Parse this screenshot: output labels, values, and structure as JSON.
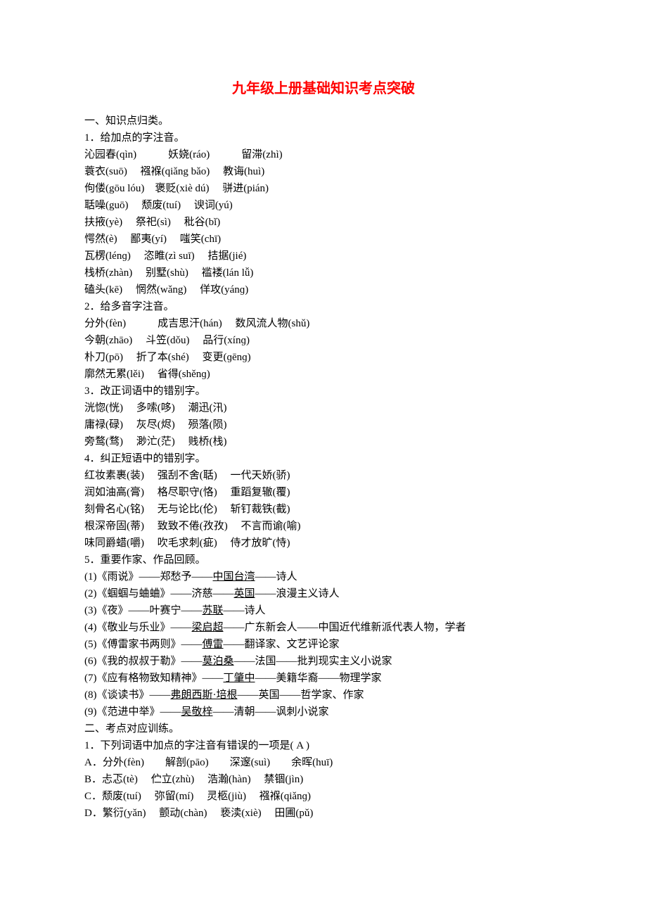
{
  "title": "九年级上册基础知识考点突破",
  "section1_heading": "一、知识点归类。",
  "q1_heading": "1．给加点的字注音。",
  "q1_lines": [
    "沁园春(qìn)　　　妖娆(ráo)　　　留滞(zhì)",
    "蓑衣(suō)　 襁褓(qiǎng bǎo)　 教诲(huì)",
    "佝偻(gōu lóu)　褒贬(xiè dú)　 骈进(pián)",
    "聒噪(guō)　 颓废(tuí)　 谀词(yú)",
    "扶掖(yè)　 祭祀(sì)　 秕谷(bǐ)",
    "愕然(è)　 鄙夷(yí)　 嗤笑(chī)",
    "瓦楞(lénɡ)　 恣睢(zì suī)　 拮据(jié)",
    "栈桥(zhàn)　 别墅(shù)　 褴褛(lán lǚ)",
    "磕头(kē)　 惘然(wǎng)　 佯攻(yánɡ)"
  ],
  "q2_heading": "2．给多音字注音。",
  "q2_lines": [
    "分外(fèn)　　　成吉思汗(hán)　 数风流人物(shǔ)",
    "今朝(zhāo)　 斗笠(dǒu)　 品行(xínɡ)",
    "朴刀(pō)　 折了本(shé)　 变更(ɡēnɡ)",
    "廓然无累(lěi)　 省得(shěnɡ)"
  ],
  "q3_heading": "3．改正词语中的错别字。",
  "q3_lines": [
    "洸惚(恍)　 多嗦(哆)　 潮迅(汛)",
    "庸禄(碌)　 灰尽(烬)　 殒落(陨)",
    "旁鹜(骛)　 渺汒(茫)　 贱桥(栈)"
  ],
  "q4_heading": "4．纠正短语中的错别字。",
  "q4_lines": [
    "红妆素裹(装)　 强刮不舍(聒)　 一代天娇(骄)",
    "润如油高(膏)　 格尽职守(恪)　 重蹈复辙(覆)",
    "刻骨名心(铭)　 无与论比(伦)　 斩钉裁铁(截)",
    "根深帝固(蒂)　 致致不倦(孜孜)　 不言而谕(喻)",
    "味同爵蜡(嚼)　 吹毛求刺(疵)　 侍才放旷(恃)"
  ],
  "q5_heading": "5．重要作家、作品回顾。",
  "q5_items": [
    {
      "pre": "(1)《雨说》——郑愁予——",
      "u": "中国台湾",
      "post": "——诗人"
    },
    {
      "pre": "(2)《蝈蝈与蛐蛐》——济慈——",
      "u": "英国",
      "post": "——浪漫主义诗人"
    },
    {
      "pre": "(3)《夜》——叶赛宁——",
      "u": "苏联",
      "post": "——诗人"
    },
    {
      "pre": "(4)《敬业与乐业》——",
      "u": "梁启超",
      "post": "——广东新会人——中国近代维新派代表人物，学者"
    },
    {
      "pre": "(5)《傅雷家书两则》——",
      "u": "傅雷",
      "post": "——翻译家、文艺评论家"
    },
    {
      "pre": "(6)《我的叔叔于勒》——",
      "u": "莫泊桑",
      "post": "——法国——批判现实主义小说家"
    },
    {
      "pre": "(7)《应有格物致知精神》——",
      "u": "丁肇中",
      "post": "——美籍华裔——物理学家"
    },
    {
      "pre": "(8)《谈读书》——",
      "u": "弗朗西斯·培根",
      "post": "——英国——哲学家、作家"
    },
    {
      "pre": "(9)《范进中举》——",
      "u": "吴敬梓",
      "post": "——清朝——讽刺小说家"
    }
  ],
  "section2_heading": "二、考点对应训练。",
  "ex1_heading": "1．下列词语中加点的字注音有错误的一项是( A )",
  "ex1_options": [
    "A．分外(fèn)　　解剖(pāo)　　深邃(suì)　　余晖(huī)",
    "B．忐忑(tè)　 伫立(zhù)　 浩瀚(hàn)　 禁锢(jìn)",
    "C．颓废(tuí)　 弥留(mí)　 灵柩(jiù)　 襁褓(qiǎnɡ)",
    "D．繁衍(yǎn)　 颤动(chàn)　 亵渎(xiè)　 田圃(pǔ)"
  ]
}
